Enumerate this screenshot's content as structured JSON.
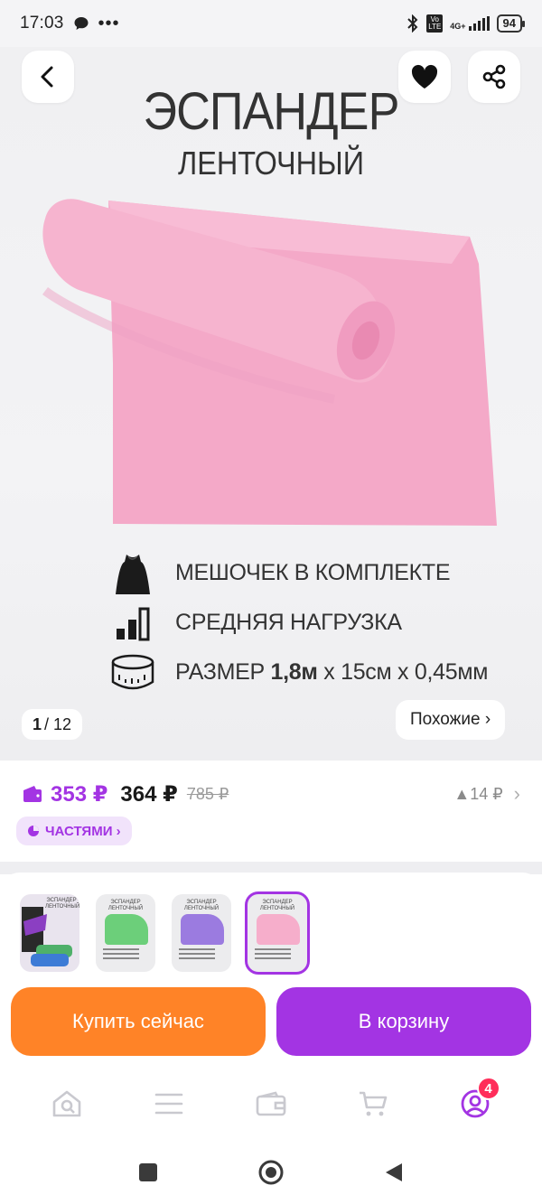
{
  "status_bar": {
    "time": "17:03",
    "network_top": "4G+",
    "volte": "Vo LTE",
    "battery": "94"
  },
  "gallery": {
    "title": "ЭСПАНДЕР",
    "subtitle": "ЛЕНТОЧНЫЙ",
    "features": [
      {
        "icon": "pouch-icon",
        "text": "МЕШОЧЕК В КОМПЛЕКТЕ"
      },
      {
        "icon": "load-bars-icon",
        "text": "СРЕДНЯЯ НАГРУЗКА"
      },
      {
        "icon": "tape-measure-icon",
        "text_prefix": "РАЗМЕР ",
        "text_bold": "1,8м",
        "text_suffix": " x 15см x 0,45мм"
      }
    ],
    "counter_current": "1",
    "counter_total": "/ 12",
    "similar_label": "Похожие ›",
    "product_color": "#f6aecb"
  },
  "price": {
    "wallet_price": "353 ₽",
    "price": "364 ₽",
    "old_price": "785 ₽",
    "delta": "▲14 ₽",
    "parts_label": "ЧАСТЯМИ ›"
  },
  "variants": [
    {
      "title": "ЭСПАНДЕР ЛЕНТОЧНЫЙ",
      "color": "#8b3fc2",
      "selected": false
    },
    {
      "title": "ЭСПАНДЕР ЛЕНТОЧНЫЙ",
      "color": "#6ccf7a",
      "selected": false
    },
    {
      "title": "ЭСПАНДЕР ЛЕНТОЧНЫЙ",
      "color": "#9b7be0",
      "selected": false
    },
    {
      "title": "ЭСПАНДЕР ЛЕНТОЧНЫЙ",
      "color": "#f6aecb",
      "selected": true
    }
  ],
  "actions": {
    "buy_now": "Купить сейчас",
    "to_cart": "В корзину"
  },
  "bottom_nav": {
    "profile_badge": "4"
  },
  "colors": {
    "accent_purple": "#a334e3",
    "accent_orange": "#ff8327",
    "badge_red": "#ff2d5a"
  }
}
